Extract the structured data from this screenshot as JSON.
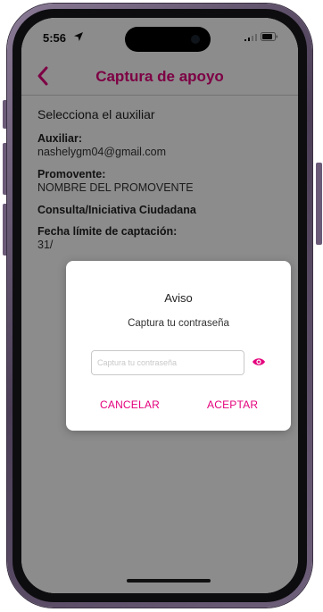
{
  "status_bar": {
    "time": "5:56",
    "icons": [
      "location-arrow-icon",
      "signal-icon",
      "battery-icon"
    ]
  },
  "nav": {
    "title": "Captura de apoyo",
    "back_icon": "chevron-left-icon"
  },
  "content": {
    "section_heading": "Selecciona el auxiliar",
    "fields": [
      {
        "label": "Auxiliar:",
        "value": "nashelygm04@gmail.com"
      },
      {
        "label": "Promovente:",
        "value": "NOMBRE DEL PROMOVENTE"
      }
    ],
    "consulta_label": "Consulta/Iniciativa Ciudadana",
    "fecha_label": "Fecha límite de captación:",
    "fecha_value": "31/"
  },
  "dialog": {
    "title": "Aviso",
    "message": "Captura tu contraseña",
    "input_placeholder": "Captura tu contraseña",
    "input_value": "",
    "eye_icon": "eye-icon",
    "cancel_label": "CANCELAR",
    "accept_label": "ACEPTAR"
  },
  "colors": {
    "accent": "#e4007c",
    "phone_frame": "#5b4c68",
    "overlay": "rgba(0,0,0,0.45)"
  }
}
